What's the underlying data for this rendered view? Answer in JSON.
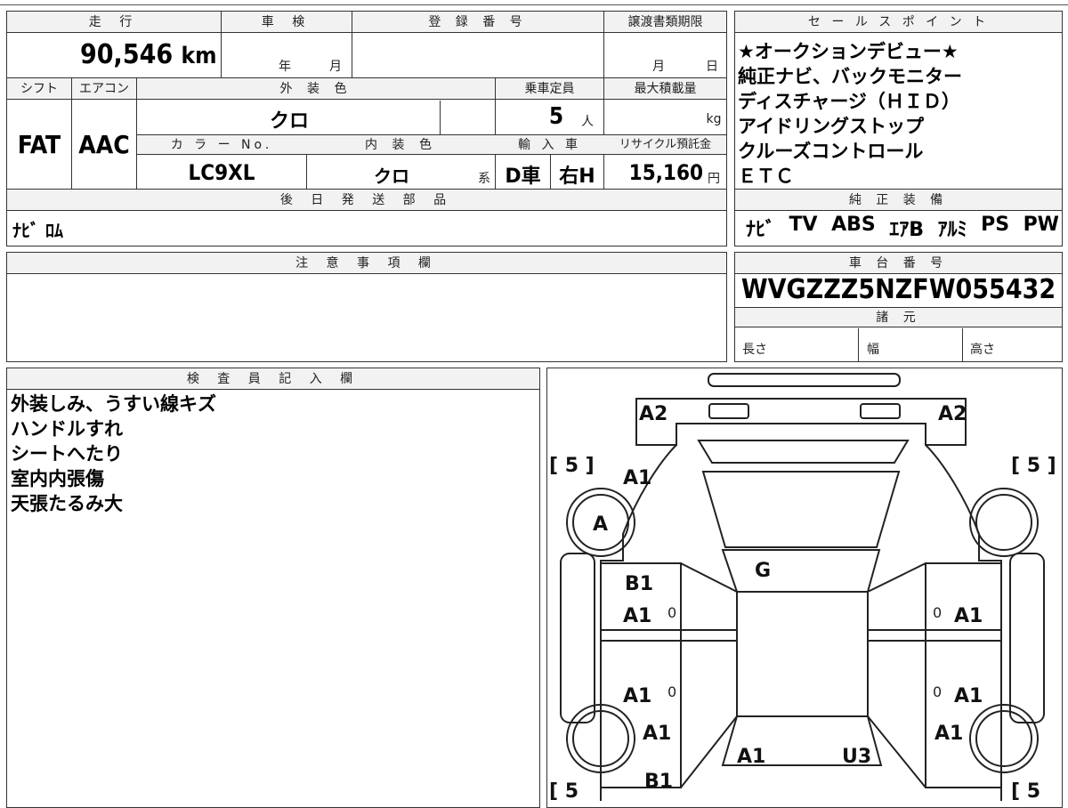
{
  "top_info": {
    "mileage_label": "走 行",
    "mileage_value": "90,546",
    "mileage_unit": "km",
    "inspection_label": "車 検",
    "inspection_year": "年",
    "inspection_month": "月",
    "registration_label": "登 録 番 号",
    "transfer_label": "譲渡書類期限",
    "transfer_month": "月",
    "transfer_day": "日",
    "shift_label": "シフト",
    "shift_value": "FAT",
    "ac_label": "エアコン",
    "ac_value": "AAC",
    "exterior_label": "外 装 色",
    "exterior_value": "クロ",
    "capacity_label": "乗車定員",
    "capacity_value": "5",
    "capacity_unit": "人",
    "load_label": "最大積載量",
    "load_unit": "kg",
    "color_no_label": "カ ラ ー No.",
    "color_no_value": "LC9XL",
    "interior_label": "内 装 色",
    "interior_value": "クロ",
    "interior_suffix": "系",
    "import_label": "輸 入 車",
    "import_value_1": "D車",
    "import_value_2": "右H",
    "recycle_label": "リサイクル預託金",
    "recycle_value": "15,160",
    "recycle_unit": "円",
    "later_parts_label": "後 日 発 送 部 品",
    "later_parts_value": "ﾅﾋﾞ ﾛﾑ"
  },
  "sales_points": {
    "label": "セ ー ル ス ポ イ ン ト",
    "lines": [
      "★オークションデビュー★",
      "純正ナビ、バックモニター",
      "ディスチャージ（ＨＩＤ）",
      "アイドリングストップ",
      "クルーズコントロール",
      "ＥＴＣ"
    ]
  },
  "equipment": {
    "label": "純 正 装 備",
    "items": [
      "ﾅﾋﾞ",
      "TV",
      "ABS",
      "ｴｱB",
      "ｱﾙﾐ",
      "PS",
      "PW"
    ]
  },
  "notes": {
    "label": "注 意 事 項 欄"
  },
  "chassis": {
    "label": "車 台 番 号",
    "value": "WVGZZZ5NZFW055432",
    "specs_label": "諸 元",
    "length_label": "長さ",
    "width_label": "幅",
    "height_label": "高さ"
  },
  "inspector": {
    "label": "検 査 員 記 入 欄",
    "lines": [
      "外装しみ、うすい線キズ",
      "ハンドルすれ",
      "シートへたり",
      "室内内張傷",
      "天張たるみ大"
    ]
  },
  "diagram": {
    "tyre_left_front": "[ 5 ]",
    "tyre_right_front": "[ 5 ]",
    "tyre_left_rear": "[ 5",
    "tyre_right_rear": "[ 5",
    "marks": {
      "front_left_corner": "A2",
      "front_right_corner": "A2",
      "hood_left": "A1",
      "wheel_a": "A",
      "windshield": "G",
      "front_door_left_1": "B1",
      "front_door_left_2": "A1",
      "front_door_right": "A1",
      "rear_door_left": "A1",
      "rear_door_right": "A1",
      "rear_fender_left": "A1",
      "rear_fender_right": "A1",
      "rear_center": "A1",
      "rear_right": "U3",
      "rear_bottom_left": "B1",
      "zero_1": "0",
      "zero_2": "0",
      "zero_3": "0",
      "zero_4": "0"
    }
  }
}
